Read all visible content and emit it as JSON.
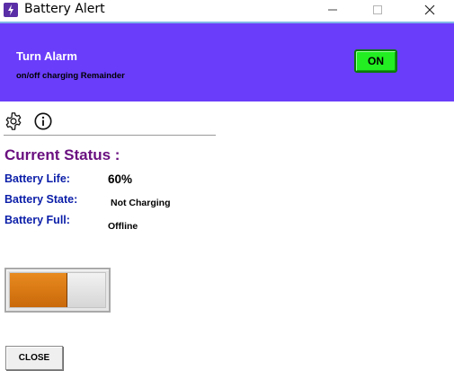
{
  "window": {
    "title": "Battery Alert",
    "app_icon": "battery-alert-app-icon",
    "controls": [
      "minimize-icon",
      "maximize-icon",
      "close-icon"
    ]
  },
  "header": {
    "title": "Turn Alarm",
    "subtitle": "on/off  charging Remainder",
    "toggle_label": "ON",
    "background_color": "#6a3dfa",
    "toggle_color": "#22ee22"
  },
  "toolbar": {
    "icons": [
      "gear-icon",
      "info-icon"
    ]
  },
  "status": {
    "heading": "Current Status :",
    "battery_life_label": "Battery Life:",
    "battery_life_value": "60%",
    "battery_state_label": "Battery State:",
    "battery_state_value": "Not Charging",
    "battery_full_label": "Battery Full:",
    "battery_full_value": "Offline",
    "label_color": "#0b1ea8",
    "heading_color": "#6a1080"
  },
  "battery_bar": {
    "level": 0.6,
    "fill_color": "#d97a14"
  },
  "footer": {
    "close_label": "CLOSE"
  }
}
